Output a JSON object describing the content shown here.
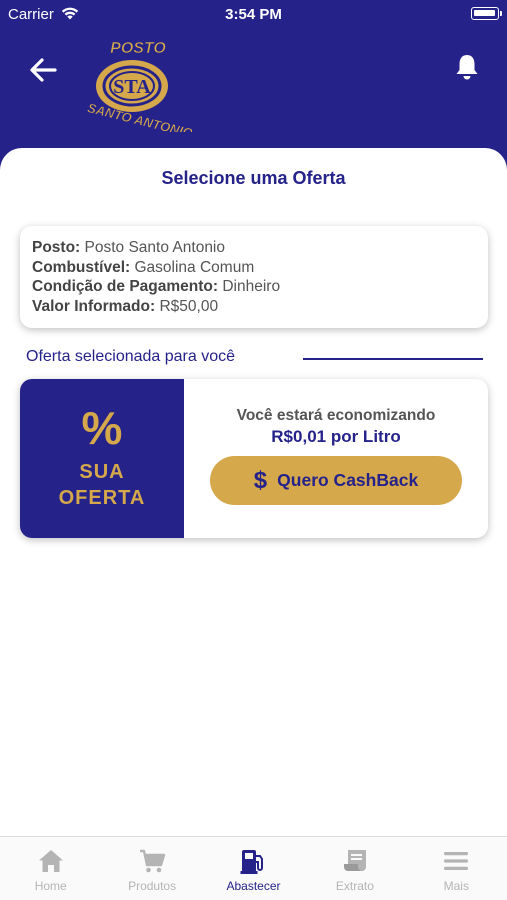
{
  "status_bar": {
    "carrier": "Carrier",
    "time": "3:54 PM"
  },
  "header": {
    "logo_top_text": "POSTO",
    "logo_bottom_text": "SANTO ANTONIO",
    "logo_monogram": "STA",
    "back_icon": "arrow-left-icon",
    "notification_icon": "bell-icon"
  },
  "page": {
    "title": "Selecione uma Oferta"
  },
  "info": {
    "posto_label": "Posto:",
    "posto_value": "Posto Santo Antonio",
    "combustivel_label": "Combustível:",
    "combustivel_value": "Gasolina Comum",
    "pagamento_label": "Condição de Pagamento:",
    "pagamento_value": "Dinheiro",
    "valor_label": "Valor Informado:",
    "valor_value": "R$50,00"
  },
  "section": {
    "label": "Oferta selecionada para você"
  },
  "offer": {
    "percent_symbol": "%",
    "sua": "SUA",
    "oferta": "OFERTA",
    "saving_text": "Você estará economizando",
    "saving_value": "R$0,01 por Litro",
    "button_symbol": "$",
    "button_label": "Quero CashBack"
  },
  "tabs": [
    {
      "label": "Home",
      "icon": "home-icon",
      "active": false
    },
    {
      "label": "Produtos",
      "icon": "cart-icon",
      "active": false
    },
    {
      "label": "Abastecer",
      "icon": "fuel-pump-icon",
      "active": true
    },
    {
      "label": "Extrato",
      "icon": "receipt-icon",
      "active": false
    },
    {
      "label": "Mais",
      "icon": "menu-icon",
      "active": false
    }
  ],
  "colors": {
    "primary": "#25228a",
    "gold": "#d4a84b",
    "inactive_tab": "#b4b4b4"
  }
}
